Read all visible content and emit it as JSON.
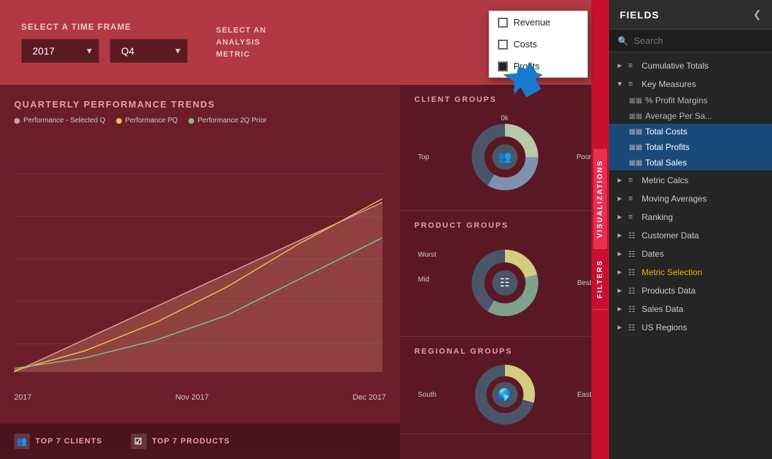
{
  "header": {
    "time_frame_label": "SELECT A TIME FRAME",
    "year_value": "2017",
    "quarter_value": "Q4",
    "metric_label_line1": "SELECT AN",
    "metric_label_line2": "ANALYSIS",
    "metric_label_line3": "METRIC"
  },
  "metric_popup": {
    "items": [
      {
        "label": "Revenue",
        "checked": false
      },
      {
        "label": "Costs",
        "checked": false
      },
      {
        "label": "Profits",
        "checked": true
      }
    ]
  },
  "chart": {
    "title": "QUARTERLY PERFORMANCE TRENDS",
    "legend": [
      {
        "label": "Performance - Selected Q",
        "color": "none"
      },
      {
        "label": "Performance PQ",
        "color": "yellow"
      },
      {
        "label": "Performance 2Q Prior",
        "color": "green"
      }
    ],
    "x_labels": [
      "2017",
      "Nov 2017",
      "Dec 2017"
    ]
  },
  "groups": [
    {
      "title": "CLIENT GROUPS",
      "labels": {
        "top": "0k",
        "right": "Poor",
        "left": "Top"
      }
    },
    {
      "title": "PRODUCT GROUPS",
      "labels": {
        "left": "Worst",
        "right": "Best",
        "center_left": "Mid"
      }
    },
    {
      "title": "REGIONAL GROUPS",
      "labels": {
        "left": "South",
        "right": "East"
      }
    }
  ],
  "bottom_bar": {
    "items": [
      {
        "label": "TOP 7 CLIENTS"
      },
      {
        "label": "TOP 7 PRODUCTS"
      }
    ]
  },
  "side_tabs": {
    "visualizations": "VISUALIZATIONS",
    "filters": "FILTERS"
  },
  "fields_panel": {
    "title": "FIELDS",
    "search_placeholder": "Search",
    "groups": [
      {
        "label": "Cumulative Totals",
        "expanded": false,
        "items": []
      },
      {
        "label": "Key Measures",
        "expanded": true,
        "items": [
          {
            "label": "% Profit Margins",
            "highlighted": false
          },
          {
            "label": "Average Per Sa...",
            "highlighted": false
          },
          {
            "label": "Total Costs",
            "highlighted": true
          },
          {
            "label": "Total Profits",
            "highlighted": true
          },
          {
            "label": "Total Sales",
            "highlighted": true
          }
        ]
      },
      {
        "label": "Metric Calcs",
        "expanded": false,
        "items": []
      },
      {
        "label": "Moving Averages",
        "expanded": false,
        "items": []
      },
      {
        "label": "Ranking",
        "expanded": false,
        "items": []
      },
      {
        "label": "Customer Data",
        "expanded": false,
        "items": []
      },
      {
        "label": "Dates",
        "expanded": false,
        "items": []
      },
      {
        "label": "Metric Selection",
        "expanded": false,
        "items": [],
        "yellow": true
      },
      {
        "label": "Products Data",
        "expanded": false,
        "items": []
      },
      {
        "label": "Sales Data",
        "expanded": false,
        "items": []
      },
      {
        "label": "US Regions",
        "expanded": false,
        "items": []
      }
    ]
  }
}
